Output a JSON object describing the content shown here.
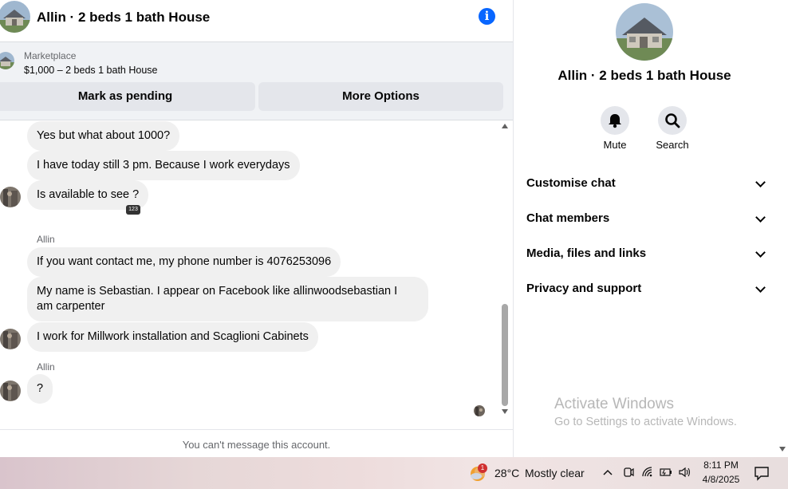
{
  "header": {
    "title": "Allin · 2 beds 1 bath House",
    "info_icon": "info-icon"
  },
  "listing": {
    "source_label": "Marketplace",
    "price_title": "$1,000 – 2 beds 1 bath House",
    "actions": {
      "mark_pending": "Mark as pending",
      "more_options": "More Options"
    }
  },
  "messages": {
    "m1": "Yes but what about 1000?",
    "m2": "I have today still 3 pm. Because I work everydays",
    "m3": "Is available to see ?",
    "m3_tag": "123",
    "sender2": "Allin",
    "m4": "If you want contact me, my phone number is 4076253096",
    "m5_line1": "My name is Sebastian.  I appear on Facebook like allinwoodsebastian I",
    "m5_line2": "am carpenter",
    "m6": "I work for Millwork installation and Scaglioni Cabinets",
    "sender3": "Allin",
    "m7": "?"
  },
  "footer": {
    "notice": "You can't message this account."
  },
  "info_pane": {
    "title": "Allin · 2 beds 1 bath House",
    "actions": {
      "mute": "Mute",
      "search": "Search"
    },
    "sections": [
      "Customise chat",
      "Chat members",
      "Media, files and links",
      "Privacy and support"
    ]
  },
  "watermark": {
    "line1": "Activate Windows",
    "line2": "Go to Settings to activate Windows."
  },
  "taskbar": {
    "weather_badge": "1",
    "temperature": "28°C",
    "condition": "Mostly clear",
    "time": "8:11 PM",
    "date": "4/8/2025"
  },
  "colors": {
    "accent": "#0866ff",
    "bubble": "#f0f0f0",
    "button": "#e4e6eb"
  }
}
